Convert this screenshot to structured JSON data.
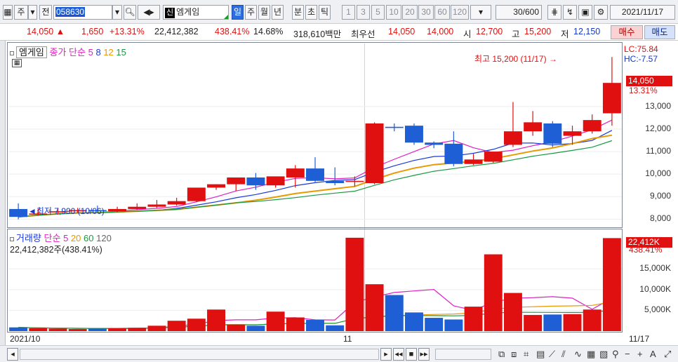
{
  "toolbar": {
    "type_label": "주",
    "prefix_label": "전",
    "code": "058630",
    "shin_label": "신",
    "stock_name": "엠게임",
    "periods": [
      "일",
      "주",
      "월",
      "년",
      "분",
      "초",
      "틱"
    ],
    "minutes": [
      "1",
      "3",
      "5",
      "10",
      "20",
      "30",
      "60",
      "120"
    ],
    "count_value": "30",
    "count_total": "/600",
    "date": "2021/11/17"
  },
  "quote": {
    "price": "14,050",
    "arrow": "▲",
    "change": "1,650",
    "change_pct": "+13.31%",
    "volume": "22,412,382",
    "volume_ratio": "438.41%",
    "turnover": "14.68%",
    "amount": "318,610백만",
    "best_label": "최우선",
    "best_ask": "14,050",
    "best_bid": "14,000",
    "open_label": "시",
    "open": "12,700",
    "high_label": "고",
    "high": "15,200",
    "low_label": "저",
    "low": "12,150",
    "buy_label": "매수",
    "sell_label": "매도"
  },
  "price_pane": {
    "name": "엠게임",
    "ma_label": "종가 단순",
    "ma_periods": [
      "5",
      "8",
      "12",
      "15"
    ],
    "lc": "LC:75.84",
    "hc": "HC:-7.57",
    "current_tag": "14,050",
    "current_pct": "13.31%",
    "high_annotation": "최고 15,200 (11/17)",
    "low_annotation": "최저 7,990 (10/06)",
    "y_ticks": [
      "13,000",
      "12,000",
      "11,000",
      "10,000",
      "9,000",
      "8,000"
    ]
  },
  "volume_pane": {
    "title": "거래량",
    "ma_label": "단순",
    "ma_periods": [
      "5",
      "20",
      "60",
      "120"
    ],
    "value_text": "22,412,382주(438.41%)",
    "current_tag": "22,412K",
    "current_pct": "438.41%",
    "y_ticks": [
      "15,000K",
      "10,000K",
      "5,000K"
    ]
  },
  "x_labels": {
    "start": "2021/10",
    "mid": "11",
    "end": "11/17"
  },
  "colors": {
    "up": "#e01010",
    "down": "#1e5fd6",
    "ma5": "#e020c0",
    "ma8": "#1a3ad8",
    "ma12": "#e89a00",
    "ma15": "#1a9a40"
  },
  "chart_data": {
    "type": "candlestick",
    "x": [
      "10/05",
      "10/06",
      "10/07",
      "10/08",
      "10/12",
      "10/13",
      "10/14",
      "10/15",
      "10/18",
      "10/19",
      "10/20",
      "10/21",
      "10/22",
      "10/25",
      "10/26",
      "10/27",
      "10/28",
      "10/29",
      "11/01",
      "11/02",
      "11/03",
      "11/04",
      "11/05",
      "11/08",
      "11/09",
      "11/10",
      "11/11",
      "11/12",
      "11/15",
      "11/16",
      "11/17"
    ],
    "open": [
      8450,
      8200,
      8300,
      8350,
      8400,
      8350,
      8450,
      8550,
      8650,
      8800,
      9400,
      9550,
      9850,
      9500,
      9850,
      10250,
      9700,
      9700,
      9600,
      12100,
      12150,
      11400,
      11350,
      10450,
      10550,
      11300,
      11900,
      12250,
      11700,
      11900,
      12700
    ],
    "high": [
      8700,
      8450,
      8500,
      8500,
      8600,
      8550,
      8700,
      8850,
      8950,
      9350,
      9550,
      9800,
      10050,
      9600,
      10400,
      10750,
      10300,
      9900,
      12300,
      12250,
      12250,
      11450,
      11900,
      10900,
      11000,
      13200,
      12800,
      12350,
      12150,
      12650,
      15200
    ],
    "low": [
      7990,
      8150,
      8200,
      8300,
      8350,
      8300,
      8400,
      8500,
      8600,
      8750,
      9300,
      9250,
      9300,
      9400,
      9400,
      9650,
      9500,
      9450,
      9550,
      11900,
      11300,
      11150,
      10350,
      10400,
      10500,
      11200,
      11700,
      11200,
      11300,
      11800,
      12150
    ],
    "close": [
      8100,
      8250,
      8350,
      8400,
      8350,
      8450,
      8550,
      8650,
      8800,
      9400,
      9550,
      9850,
      9500,
      9900,
      10250,
      9700,
      9600,
      9700,
      12250,
      12050,
      11400,
      11300,
      10450,
      10650,
      11000,
      11900,
      12300,
      11350,
      11900,
      12400,
      14050
    ],
    "volume": [
      900,
      700,
      600,
      500,
      600,
      700,
      800,
      1300,
      2500,
      3000,
      5200,
      1600,
      1300,
      4700,
      3300,
      2700,
      1400,
      22500,
      11300,
      8700,
      4500,
      3200,
      2800,
      5900,
      18500,
      9200,
      3900,
      4000,
      4100,
      5200,
      22412
    ],
    "ylim": [
      7700,
      15800
    ],
    "volume_ylim": [
      0,
      24000
    ],
    "volume_unit": "천주"
  }
}
